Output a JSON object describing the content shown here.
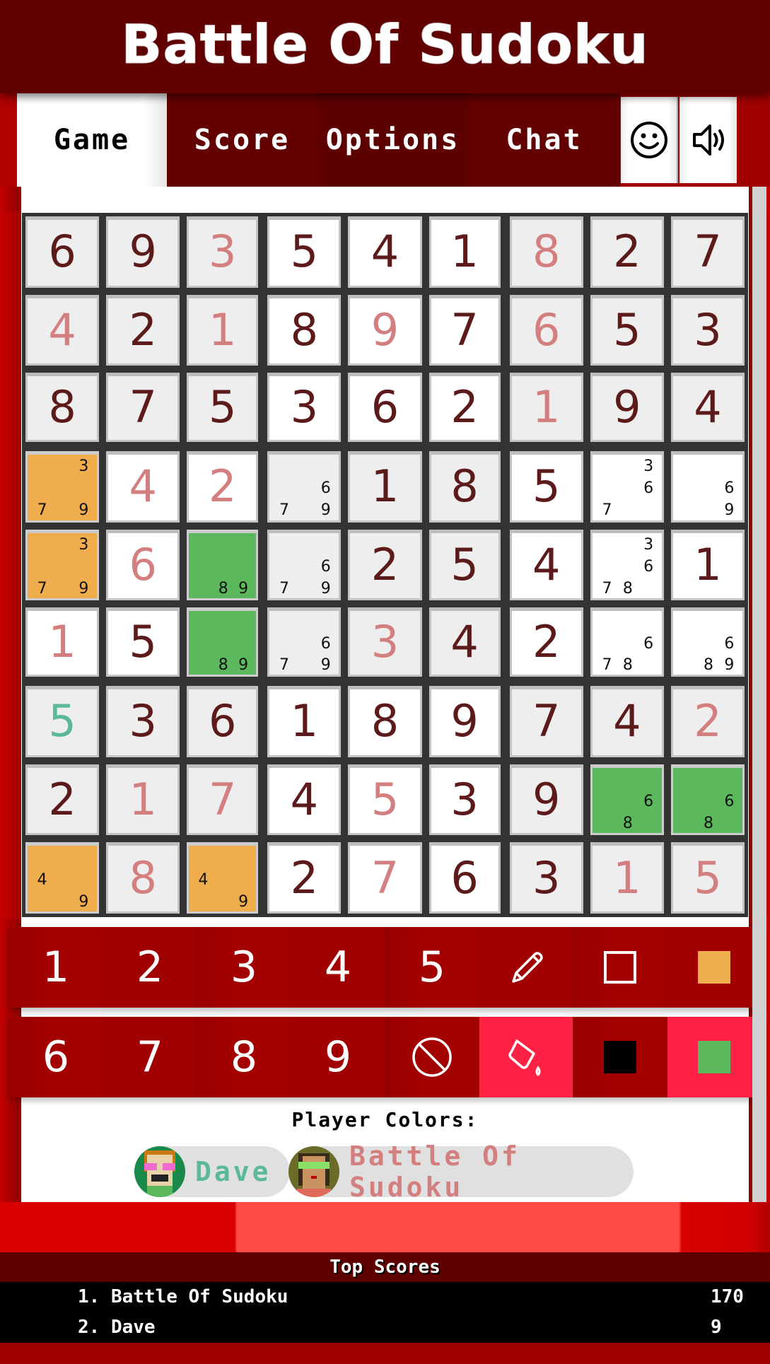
{
  "app": {
    "title": "Battle Of Sudoku"
  },
  "nav": {
    "tabs": [
      {
        "label": "Game",
        "active": true
      },
      {
        "label": "Score",
        "active": false
      },
      {
        "label": "Options",
        "active": false
      },
      {
        "label": "Chat",
        "active": false
      }
    ],
    "icons": [
      "smiley-icon",
      "speaker-icon"
    ]
  },
  "colors": {
    "accent": "#600000",
    "player_orange": "#f0ad4e",
    "player_green": "#5cb85c",
    "given_digit": "#5c1a1a",
    "player_digit_pink": "#d47f7f",
    "player_digit_teal": "#5cb89a",
    "active_tool": "#ff2244"
  },
  "board": {
    "rows": [
      [
        {
          "v": "6"
        },
        {
          "v": "9"
        },
        {
          "v": "3",
          "c": "pink"
        },
        {
          "v": "5"
        },
        {
          "v": "4"
        },
        {
          "v": "1"
        },
        {
          "v": "8",
          "c": "pink"
        },
        {
          "v": "2"
        },
        {
          "v": "7"
        }
      ],
      [
        {
          "v": "4",
          "c": "pink"
        },
        {
          "v": "2"
        },
        {
          "v": "1",
          "c": "pink"
        },
        {
          "v": "8"
        },
        {
          "v": "9",
          "c": "pink"
        },
        {
          "v": "7"
        },
        {
          "v": "6",
          "c": "pink"
        },
        {
          "v": "5"
        },
        {
          "v": "3"
        }
      ],
      [
        {
          "v": "8"
        },
        {
          "v": "7"
        },
        {
          "v": "5"
        },
        {
          "v": "3"
        },
        {
          "v": "6"
        },
        {
          "v": "2"
        },
        {
          "v": "1",
          "c": "pink"
        },
        {
          "v": "9"
        },
        {
          "v": "4"
        }
      ],
      [
        {
          "n": [
            3,
            7,
            9
          ],
          "hl": "orange"
        },
        {
          "v": "4",
          "c": "pink"
        },
        {
          "v": "2",
          "c": "pink"
        },
        {
          "n": [
            6,
            7,
            9
          ]
        },
        {
          "v": "1"
        },
        {
          "v": "8"
        },
        {
          "v": "5"
        },
        {
          "n": [
            3,
            6,
            7
          ]
        },
        {
          "n": [
            6,
            9
          ]
        }
      ],
      [
        {
          "n": [
            3,
            7,
            9
          ],
          "hl": "orange"
        },
        {
          "v": "6",
          "c": "pink"
        },
        {
          "n": [
            8,
            9
          ],
          "hl": "green"
        },
        {
          "n": [
            6,
            7,
            9
          ]
        },
        {
          "v": "2"
        },
        {
          "v": "5"
        },
        {
          "v": "4"
        },
        {
          "n": [
            3,
            6,
            7,
            8
          ]
        },
        {
          "v": "1"
        }
      ],
      [
        {
          "v": "1",
          "c": "pink"
        },
        {
          "v": "5"
        },
        {
          "n": [
            8,
            9
          ],
          "hl": "green"
        },
        {
          "n": [
            6,
            7,
            9
          ]
        },
        {
          "v": "3",
          "c": "pink"
        },
        {
          "v": "4"
        },
        {
          "v": "2"
        },
        {
          "n": [
            6,
            7,
            8
          ]
        },
        {
          "n": [
            6,
            8,
            9
          ]
        }
      ],
      [
        {
          "v": "5",
          "c": "teal"
        },
        {
          "v": "3"
        },
        {
          "v": "6"
        },
        {
          "v": "1"
        },
        {
          "v": "8"
        },
        {
          "v": "9"
        },
        {
          "v": "7"
        },
        {
          "v": "4"
        },
        {
          "v": "2",
          "c": "pink"
        }
      ],
      [
        {
          "v": "2"
        },
        {
          "v": "1",
          "c": "pink"
        },
        {
          "v": "7",
          "c": "pink"
        },
        {
          "v": "4"
        },
        {
          "v": "5",
          "c": "pink"
        },
        {
          "v": "3"
        },
        {
          "v": "9"
        },
        {
          "n": [
            6,
            8
          ],
          "hl": "green"
        },
        {
          "n": [
            6,
            8
          ],
          "hl": "green"
        }
      ],
      [
        {
          "n": [
            4,
            9
          ],
          "hl": "orange"
        },
        {
          "v": "8",
          "c": "pink"
        },
        {
          "n": [
            4,
            9
          ],
          "hl": "orange"
        },
        {
          "v": "2"
        },
        {
          "v": "7",
          "c": "pink"
        },
        {
          "v": "6"
        },
        {
          "v": "3"
        },
        {
          "v": "1",
          "c": "pink"
        },
        {
          "v": "5",
          "c": "pink"
        }
      ]
    ]
  },
  "pad": {
    "row1": [
      {
        "label": "1",
        "type": "digit"
      },
      {
        "label": "2",
        "type": "digit"
      },
      {
        "label": "3",
        "type": "digit"
      },
      {
        "label": "4",
        "type": "digit"
      },
      {
        "label": "5",
        "type": "digit"
      },
      {
        "icon": "pencil-icon",
        "type": "tool"
      },
      {
        "icon": "empty-square-icon",
        "type": "color",
        "color": "none"
      },
      {
        "icon": "orange-swatch-icon",
        "type": "color",
        "color": "#f0ad4e"
      }
    ],
    "row2": [
      {
        "label": "6",
        "type": "digit"
      },
      {
        "label": "7",
        "type": "digit"
      },
      {
        "label": "8",
        "type": "digit"
      },
      {
        "label": "9",
        "type": "digit"
      },
      {
        "icon": "clear-icon",
        "type": "tool"
      },
      {
        "icon": "paint-bucket-icon",
        "type": "tool",
        "active": true
      },
      {
        "icon": "black-swatch-icon",
        "type": "color",
        "color": "#000000"
      },
      {
        "icon": "green-swatch-icon",
        "type": "color",
        "color": "#5cb85c",
        "active": true
      }
    ]
  },
  "players": {
    "label": "Player Colors:",
    "list": [
      {
        "name": "Dave",
        "color": "#5cb89a"
      },
      {
        "name": "Battle Of Sudoku",
        "color": "#d47f7f"
      }
    ]
  },
  "top_scores": {
    "title": "Top Scores",
    "entries": [
      {
        "rank_name": "1. Battle Of Sudoku",
        "score": "170"
      },
      {
        "rank_name": "2. Dave",
        "score": "9"
      }
    ]
  }
}
